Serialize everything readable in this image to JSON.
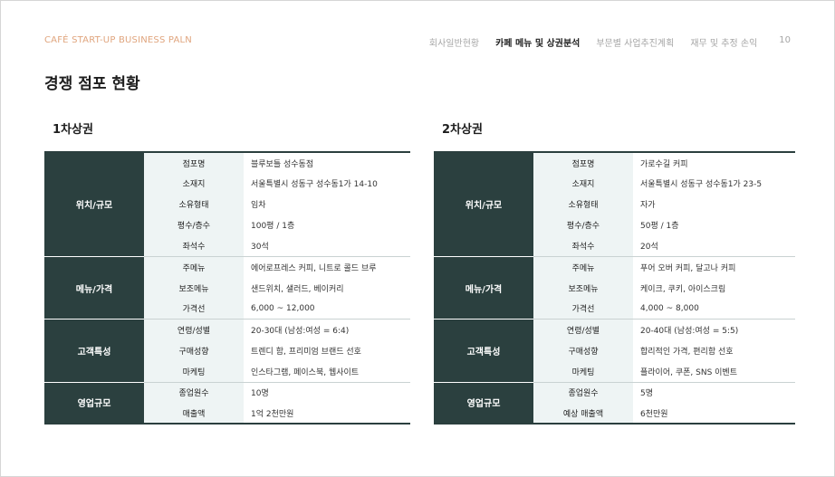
{
  "header": {
    "brand": "CAFÉ START-UP BUSINESS PALN",
    "nav": [
      "회사일반현황",
      "카페 메뉴 및 상권분석",
      "부문별 사업추진계획",
      "재무 및 추정 손익"
    ],
    "active_nav": 1,
    "page_number": "10"
  },
  "page_title": "경쟁 점포 현황",
  "tables": [
    {
      "title": "1차상권",
      "groups": [
        {
          "name": "위치/규모",
          "rows": [
            {
              "label": "점포명",
              "value": "블루보틀 성수동점"
            },
            {
              "label": "소재지",
              "value": "서울특별시 성동구 성수동1가 14-10"
            },
            {
              "label": "소유형태",
              "value": "임차"
            },
            {
              "label": "평수/층수",
              "value": "100평 / 1층"
            },
            {
              "label": "좌석수",
              "value": "30석"
            }
          ]
        },
        {
          "name": "메뉴/가격",
          "rows": [
            {
              "label": "주메뉴",
              "value": "에어로프레스 커피, 니트로 콜드 브루"
            },
            {
              "label": "보조메뉴",
              "value": "샌드위치, 샐러드, 베이커리"
            },
            {
              "label": "가격선",
              "value": "6,000 ~ 12,000"
            }
          ]
        },
        {
          "name": "고객특성",
          "rows": [
            {
              "label": "연령/성별",
              "value": "20-30대 (남성:여성 = 6:4)"
            },
            {
              "label": "구매성향",
              "value": "트렌디 함, 프리미엄 브랜드 선호"
            },
            {
              "label": "마케팅",
              "value": "인스타그램, 페이스북, 웹사이트"
            }
          ]
        },
        {
          "name": "영업규모",
          "rows": [
            {
              "label": "종업원수",
              "value": "10명"
            },
            {
              "label": "매출액",
              "value": "1억 2천만원"
            }
          ]
        }
      ]
    },
    {
      "title": "2차상권",
      "groups": [
        {
          "name": "위치/규모",
          "rows": [
            {
              "label": "점포명",
              "value": "가로수길 커피"
            },
            {
              "label": "소재지",
              "value": "서울특별시 성동구 성수동1가 23-5"
            },
            {
              "label": "소유형태",
              "value": "자가"
            },
            {
              "label": "평수/층수",
              "value": "50평 / 1층"
            },
            {
              "label": "좌석수",
              "value": "20석"
            }
          ]
        },
        {
          "name": "메뉴/가격",
          "rows": [
            {
              "label": "주메뉴",
              "value": "푸어 오버 커피, 달고나 커피"
            },
            {
              "label": "보조메뉴",
              "value": "케이크, 쿠키, 아이스크림"
            },
            {
              "label": "가격선",
              "value": "4,000 ~ 8,000"
            }
          ]
        },
        {
          "name": "고객특성",
          "rows": [
            {
              "label": "연령/성별",
              "value": "20-40대 (남성:여성 = 5:5)"
            },
            {
              "label": "구매성향",
              "value": "합리적인 가격, 편리함 선호"
            },
            {
              "label": "마케팅",
              "value": "플라이어, 쿠폰, SNS 이벤트"
            }
          ]
        },
        {
          "name": "영업규모",
          "rows": [
            {
              "label": "종업원수",
              "value": "5명"
            },
            {
              "label": "예상 매출액",
              "value": "6천만원"
            }
          ]
        }
      ]
    }
  ]
}
